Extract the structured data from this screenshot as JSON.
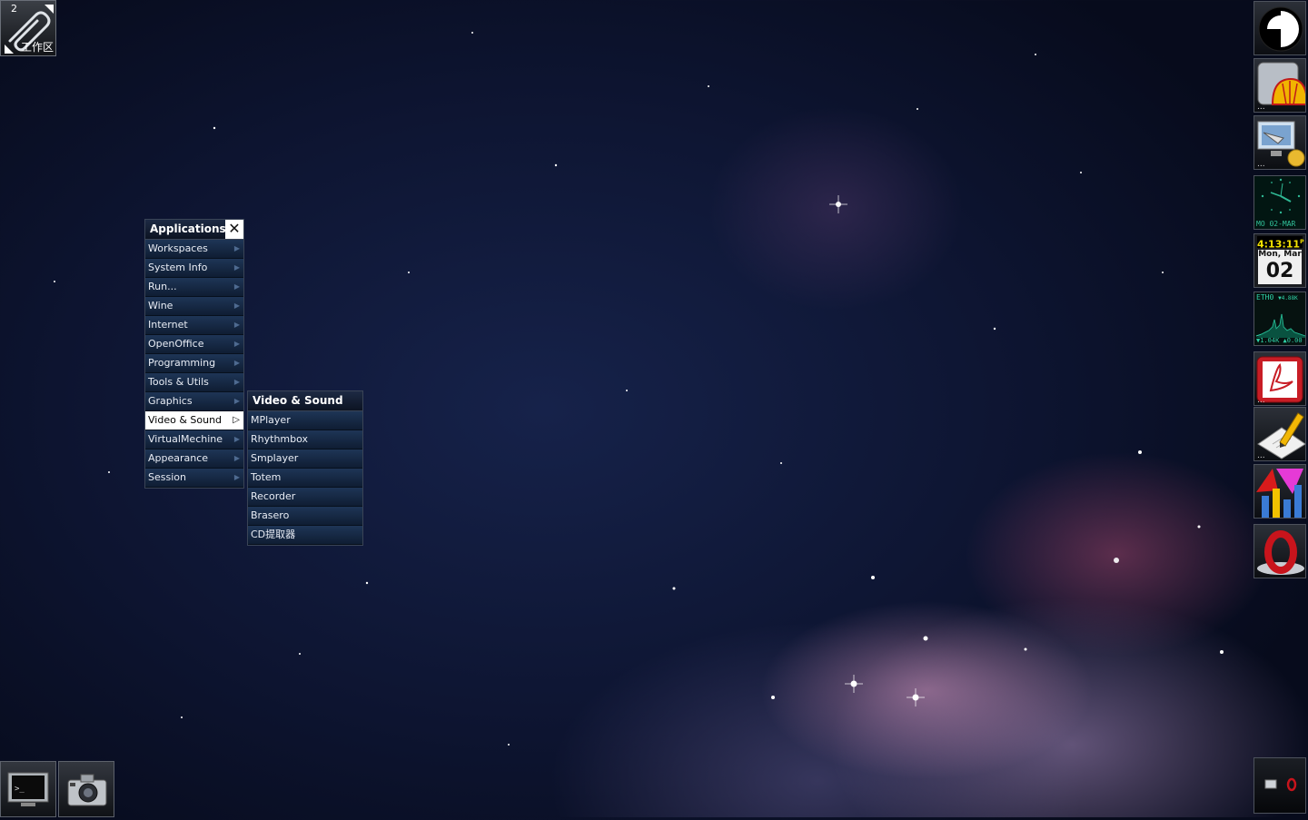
{
  "pager": {
    "workspace_number": "2",
    "label": "工作区",
    "icon": "paperclip-icon"
  },
  "menu": {
    "title": "Applications",
    "close_icon": "close-icon",
    "items": [
      {
        "label": "Workspaces"
      },
      {
        "label": "System Info"
      },
      {
        "label": "Run..."
      },
      {
        "label": "Wine"
      },
      {
        "label": "Internet"
      },
      {
        "label": "OpenOffice"
      },
      {
        "label": "Programming"
      },
      {
        "label": "Tools & Utils"
      },
      {
        "label": "Graphics"
      },
      {
        "label": "Video & Sound",
        "active": true
      },
      {
        "label": "VirtualMechine"
      },
      {
        "label": "Appearance"
      },
      {
        "label": "Session"
      }
    ]
  },
  "submenu": {
    "title": "Video & Sound",
    "items": [
      {
        "label": "MPlayer"
      },
      {
        "label": "Rhythmbox"
      },
      {
        "label": "Smplayer"
      },
      {
        "label": "Totem"
      },
      {
        "label": "Recorder"
      },
      {
        "label": "Brasero"
      },
      {
        "label": "CD提取器"
      }
    ]
  },
  "dock": {
    "analog_clock": {
      "date_text": "MO 02-MAR"
    },
    "digital_clock": {
      "time": "4:13:11",
      "suffix": "P",
      "weekday_month": "Mon, Mar",
      "day": "02"
    },
    "network_monitor": {
      "interface": "ETH0",
      "rx_rate": "▼4.88K",
      "tx_rate": "▲0.0",
      "bottom_rx": "▼1.04K",
      "bottom_tx": "▲0.00"
    }
  },
  "colors": {
    "menu_highlight": "#ffffff",
    "menu_item_bg": "#1e3556",
    "clock_time": "#f4e400",
    "net_text": "#2fd3a8"
  }
}
